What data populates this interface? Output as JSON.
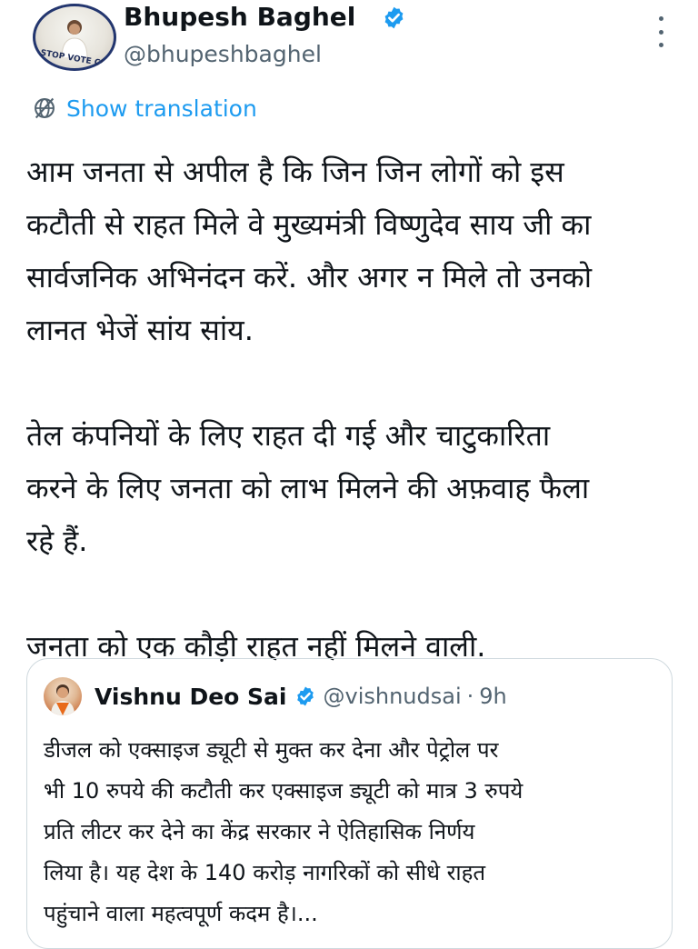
{
  "author": {
    "name": "Bhupesh Baghel",
    "handle": "@bhupeshbaghel",
    "avatar_text": "STOP VOTE CHORI",
    "verified_icon": "verified-badge-icon"
  },
  "translation": {
    "label": "Show translation",
    "icon": "translate-globe-icon"
  },
  "tweet": {
    "lines": [
      "आम जनता से अपील है कि जिन जिन लोगों को इस",
      "कटौती से राहत मिले वे मुख्यमंत्री विष्णुदेव साय जी का",
      "सार्वजनिक अभिनंदन करें. और अगर न मिले तो उनको",
      "लानत भेजें सांय सांय.",
      "तेल कंपनियों के लिए राहत दी गई और चाटुकारिता",
      "करने के लिए जनता को लाभ मिलने की अफ़वाह फैला",
      "रहे हैं.",
      "जनता को एक कौड़ी राहत नहीं मिलने वाली."
    ]
  },
  "quote": {
    "name": "Vishnu Deo Sai",
    "handle": "@vishnudsai",
    "separator": "·",
    "time": "9h",
    "lines": [
      "डीजल को एक्साइज ड्यूटी से मुक्त कर देना और पेट्रोल पर",
      "भी 10 रुपये की कटौती कर एक्साइज ड्यूटी को मात्र 3 रुपये",
      "प्रति लीटर कर देने का केंद्र सरकार ने ऐतिहासिक निर्णय",
      "लिया है। यह देश के 140 करोड़ नागरिकों को सीधे राहत",
      "पहुंचाने वाला महत्वपूर्ण कदम है।..."
    ]
  },
  "colors": {
    "accent": "#1d9bf0",
    "text": "#0f1419",
    "secondary": "#536471",
    "border": "#cfd9de"
  }
}
